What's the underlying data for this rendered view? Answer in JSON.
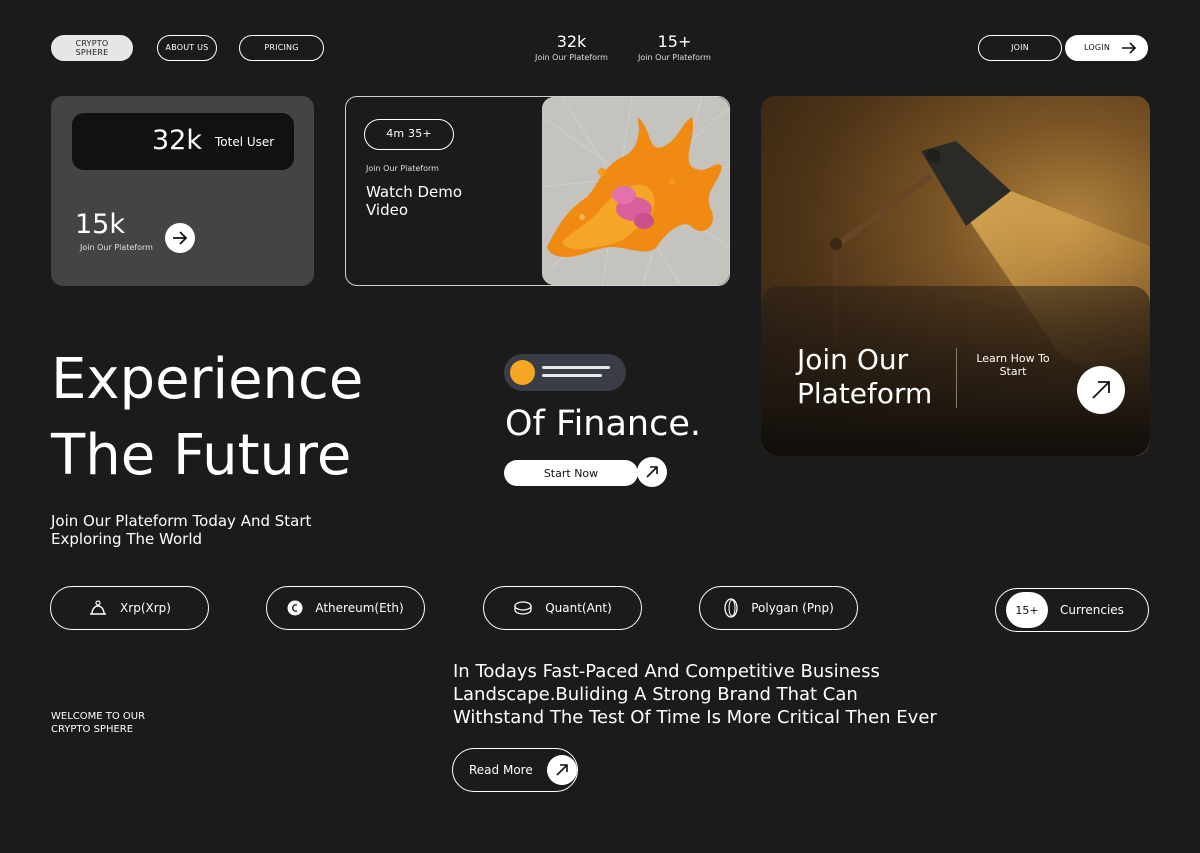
{
  "nav": {
    "brand": "CRYPTO SPHERE",
    "brand_line1": "CRYPTO",
    "brand_line2": "SPHERE",
    "about": "ABOUT US",
    "pricing": "PRICING",
    "join": "JOIN",
    "login": "LOGIN"
  },
  "header_stats": [
    {
      "value": "32k",
      "label": "Join Our Plateform"
    },
    {
      "value": "15+",
      "label": "Join Our Plateform"
    }
  ],
  "card_users": {
    "total_value": "32k",
    "total_label": "Totel User",
    "join_value": "15k",
    "join_label": "Join Our Plateform"
  },
  "card_video": {
    "duration": "4m 35+",
    "subtitle": "Join Our Plateform",
    "title_line1": "Watch Demo",
    "title_line2": "Video"
  },
  "card_join": {
    "title_line1": "Join Our",
    "title_line2": "Plateform",
    "learn_line1": "Learn How To",
    "learn_line2": "Start"
  },
  "hero": {
    "line1": "Experience",
    "line2": "The Future",
    "finance": "Of Finance.",
    "cta": "Start Now",
    "sub_line1": "Join Our Plateform Today And Start",
    "sub_line2": "Exploring The World"
  },
  "currencies": [
    {
      "label": "Xrp(Xrp)",
      "icon": "xrp-icon"
    },
    {
      "label": "Athereum(Eth)",
      "icon": "ethereum-coin-icon"
    },
    {
      "label": "Quant(Ant)",
      "icon": "quant-coin-icon"
    },
    {
      "label": "Polygan (Pnp)",
      "icon": "polygon-coin-icon"
    }
  ],
  "currencies_count": {
    "badge": "15+",
    "label": "Currencies"
  },
  "welcome": {
    "line1": "WELCOME TO OUR",
    "line2": "CRYPTO SPHERE"
  },
  "about_text": {
    "line1": "In Todays Fast-Paced And Competitive Business",
    "line2": "Landscape.Buliding A Strong Brand That Can",
    "line3": "Withstand The Test Of Time Is More Critical Then Ever"
  },
  "read_more": "Read More",
  "colors": {
    "background": "#1b1b1b",
    "accent": "#f5a623",
    "card_gray": "#444444"
  }
}
